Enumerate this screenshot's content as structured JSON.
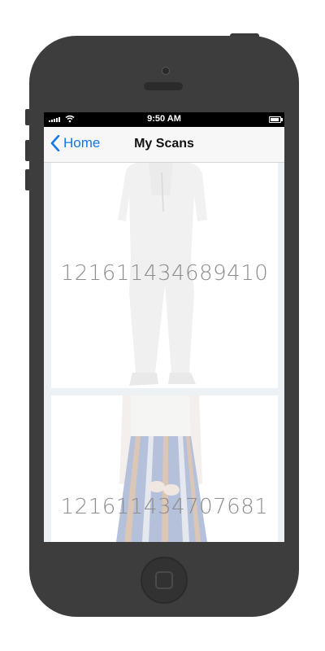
{
  "status_bar": {
    "time": "9:50 AM"
  },
  "nav": {
    "back_label": "Home",
    "title": "My Scans"
  },
  "scans": [
    {
      "code": "121611434689410"
    },
    {
      "code": "121611434707681"
    }
  ],
  "colors": {
    "accent": "#1677e6",
    "phone_body": "#3d3d3d"
  },
  "icons": {
    "back": "chevron-left-icon",
    "wifi": "wifi-icon",
    "signal": "signal-icon",
    "battery": "battery-icon",
    "home": "home-button"
  }
}
